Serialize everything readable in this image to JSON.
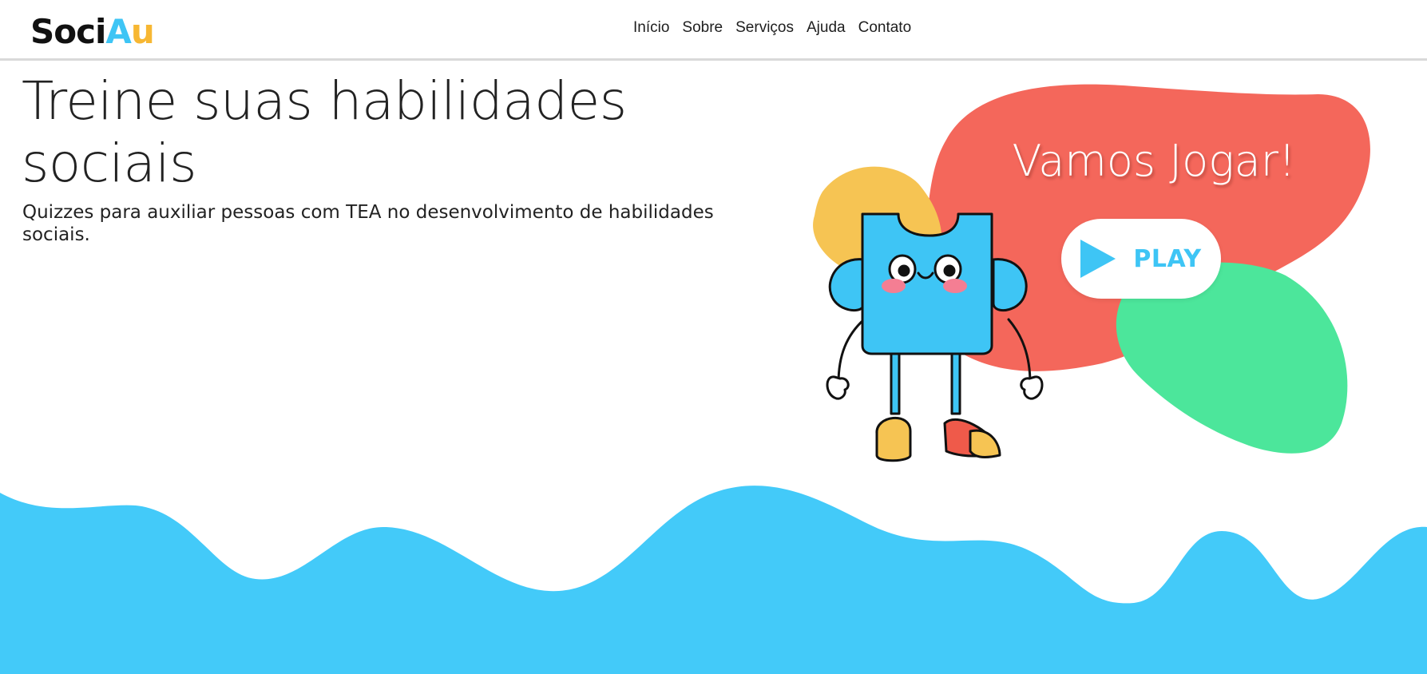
{
  "header": {
    "logo": {
      "part1": "Soci",
      "part2_letters": [
        {
          "char": "A",
          "color": "#3ec5f5"
        },
        {
          "char": "u",
          "color": "#f7b733"
        }
      ],
      "part1_color": "#111111"
    },
    "nav": [
      "Início",
      "Sobre",
      "Serviços",
      "Ajuda",
      "Contato"
    ]
  },
  "hero": {
    "title_line1": "Treine suas habilidades",
    "title_line2": "sociais",
    "subtitle": "Quizzes para auxiliar pessoas com TEA no desenvolvimento de habilidades sociais."
  },
  "cta": {
    "heading": "Vamos Jogar!",
    "button_label": "PLAY"
  },
  "colors": {
    "coral": "#f4675b",
    "yellow": "#f6c453",
    "green": "#4ce69b",
    "sky": "#43caf9",
    "mascot_blue": "#3ec5f5"
  }
}
